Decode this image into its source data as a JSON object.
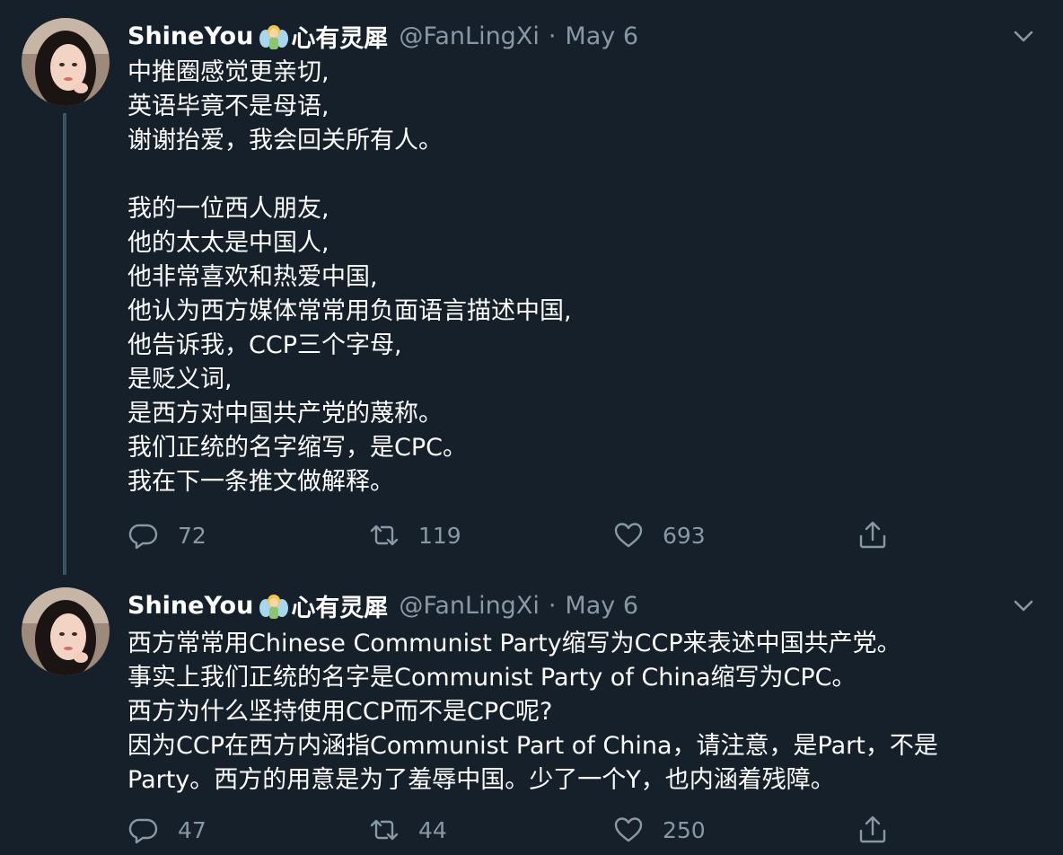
{
  "tweets": [
    {
      "display_name": "ShineYou",
      "display_name_suffix": "心有灵犀",
      "handle": "@FanLingXi",
      "separator": "·",
      "date": "May 6",
      "lines": [
        "中推圈感觉更亲切,",
        "英语毕竟不是母语,",
        "谢谢抬爱，我会回关所有人。",
        "",
        "我的一位西人朋友,",
        "他的太太是中国人,",
        "他非常喜欢和热爱中国,",
        "他认为西方媒体常常用负面语言描述中国,",
        "他告诉我，CCP三个字母,",
        "是贬义词,",
        "是西方对中国共产党的蔑称。",
        "我们正统的名字缩写，是CPC。",
        "我在下一条推文做解释。"
      ],
      "reply_count": "72",
      "retweet_count": "119",
      "like_count": "693"
    },
    {
      "display_name": "ShineYou",
      "display_name_suffix": "心有灵犀",
      "handle": "@FanLingXi",
      "separator": "·",
      "date": "May 6",
      "lines": [
        "西方常常用Chinese Communist Party缩写为CCP来表述中国共产党。",
        "事实上我们正统的名字是Communist Party of China缩写为CPC。",
        "西方为什么坚持使用CCP而不是CPC呢?",
        "因为CCP在西方内涵指Communist Part of China，请注意，是Part，不是",
        "Party。西方的用意是为了羞辱中国。少了一个Y，也内涵着残障。"
      ],
      "reply_count": "47",
      "retweet_count": "44",
      "like_count": "250"
    }
  ],
  "colors": {
    "background": "#15202b",
    "text": "#ffffff",
    "secondary": "#8899a6",
    "thread_line": "#3d5466"
  },
  "icons": {
    "emoji": "fairy-emoji",
    "menu": "chevron-down-icon",
    "reply": "reply-icon",
    "retweet": "retweet-icon",
    "like": "heart-icon",
    "share": "share-icon"
  }
}
